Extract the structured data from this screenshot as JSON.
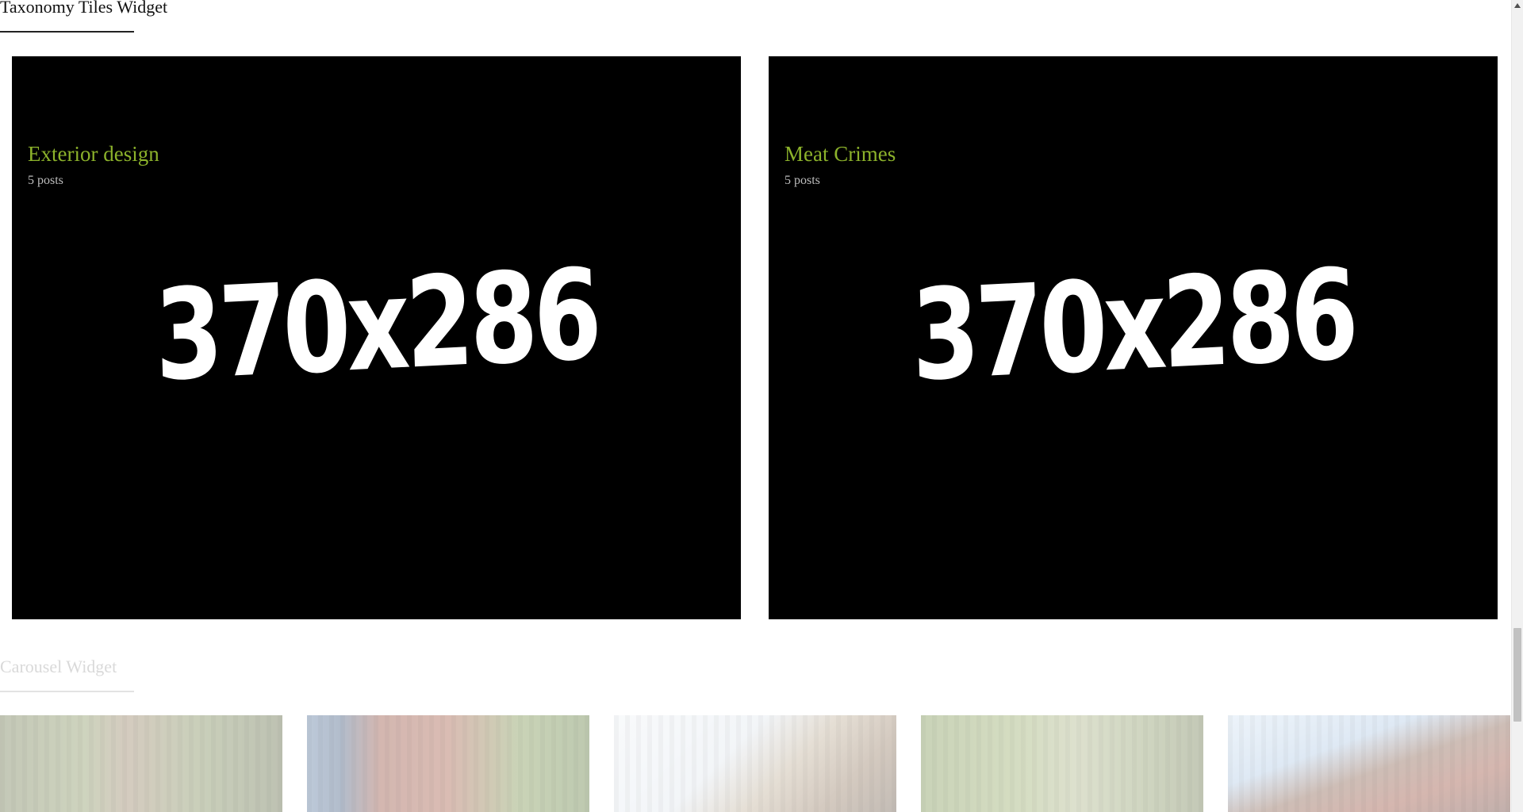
{
  "taxonomy_tiles_widget": {
    "heading": "Taxonomy Tiles Widget",
    "tiles": [
      {
        "title": "Exterior design",
        "count": "5 posts",
        "placeholder_text": "370x286"
      },
      {
        "title": "Meat Crimes",
        "count": "5 posts",
        "placeholder_text": "370x286"
      }
    ],
    "colors": {
      "tile_background": "#000000",
      "title_accent": "#8cb22b",
      "count_text": "#bdbdbd"
    }
  },
  "carousel_widget": {
    "heading": "Carousel Widget",
    "items_count": 5
  },
  "scrollbar": {
    "up_arrow_icon": "triangle-up-icon"
  }
}
